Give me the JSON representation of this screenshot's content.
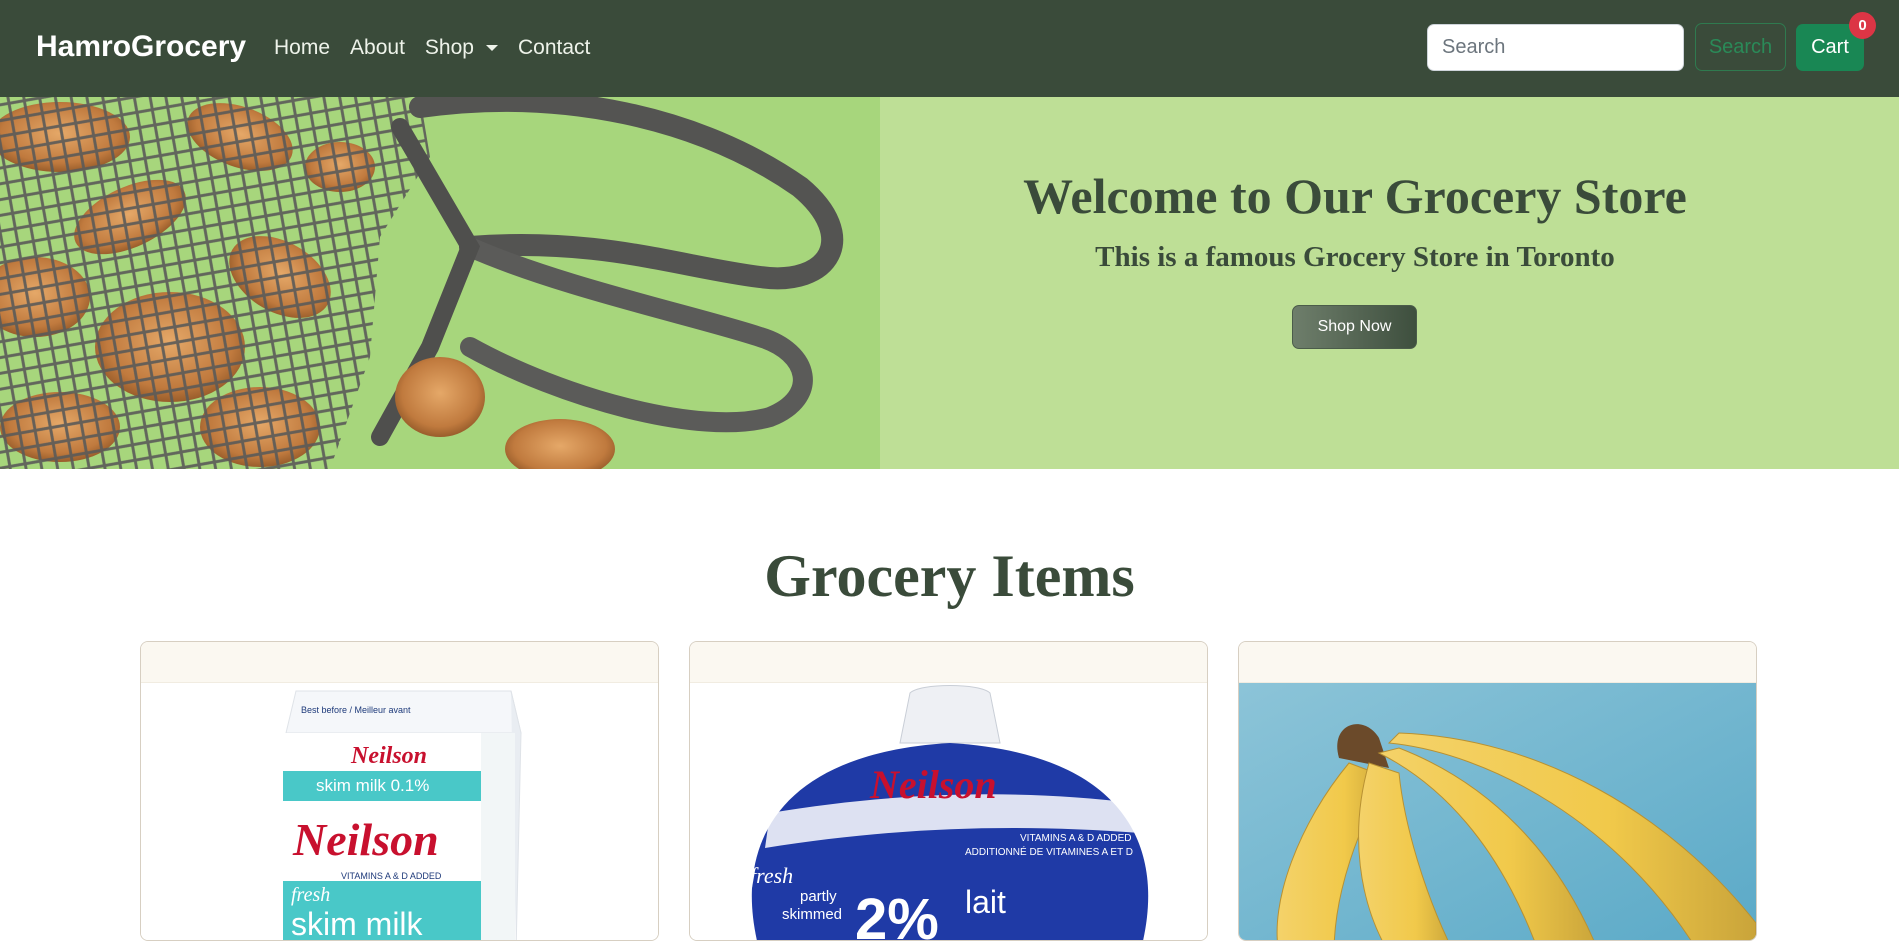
{
  "navbar": {
    "brand": "HamroGrocery",
    "links": [
      "Home",
      "About",
      "Shop",
      "Contact"
    ],
    "search_placeholder": "Search",
    "search_button": "Search",
    "cart_label": "Cart",
    "cart_count": "0"
  },
  "hero": {
    "title": "Welcome to Our Grocery Store",
    "subtitle": "This is a famous Grocery Store in Toronto",
    "cta": "Shop Now"
  },
  "section": {
    "title": "Grocery Items"
  },
  "products": [
    {
      "brand_text": "Neilson",
      "lines": [
        "Best before / Meilleur avant",
        "skim milk 0.1%",
        "VITAMINS A & D ADDED",
        "fresh",
        "skim milk"
      ]
    },
    {
      "brand_text": "Neilson",
      "lines": [
        "VITAMINS A & D ADDED",
        "ADDITIONNÉ DE VITAMINES A ET D",
        "fresh",
        "partly",
        "skimmed",
        "2%",
        "lait"
      ]
    },
    {
      "image": "bananas"
    }
  ],
  "colors": {
    "navbar_bg": "#3a4b3a",
    "hero_bg": "#bedf96",
    "accent_green": "#198754",
    "badge_red": "#dc3545"
  }
}
